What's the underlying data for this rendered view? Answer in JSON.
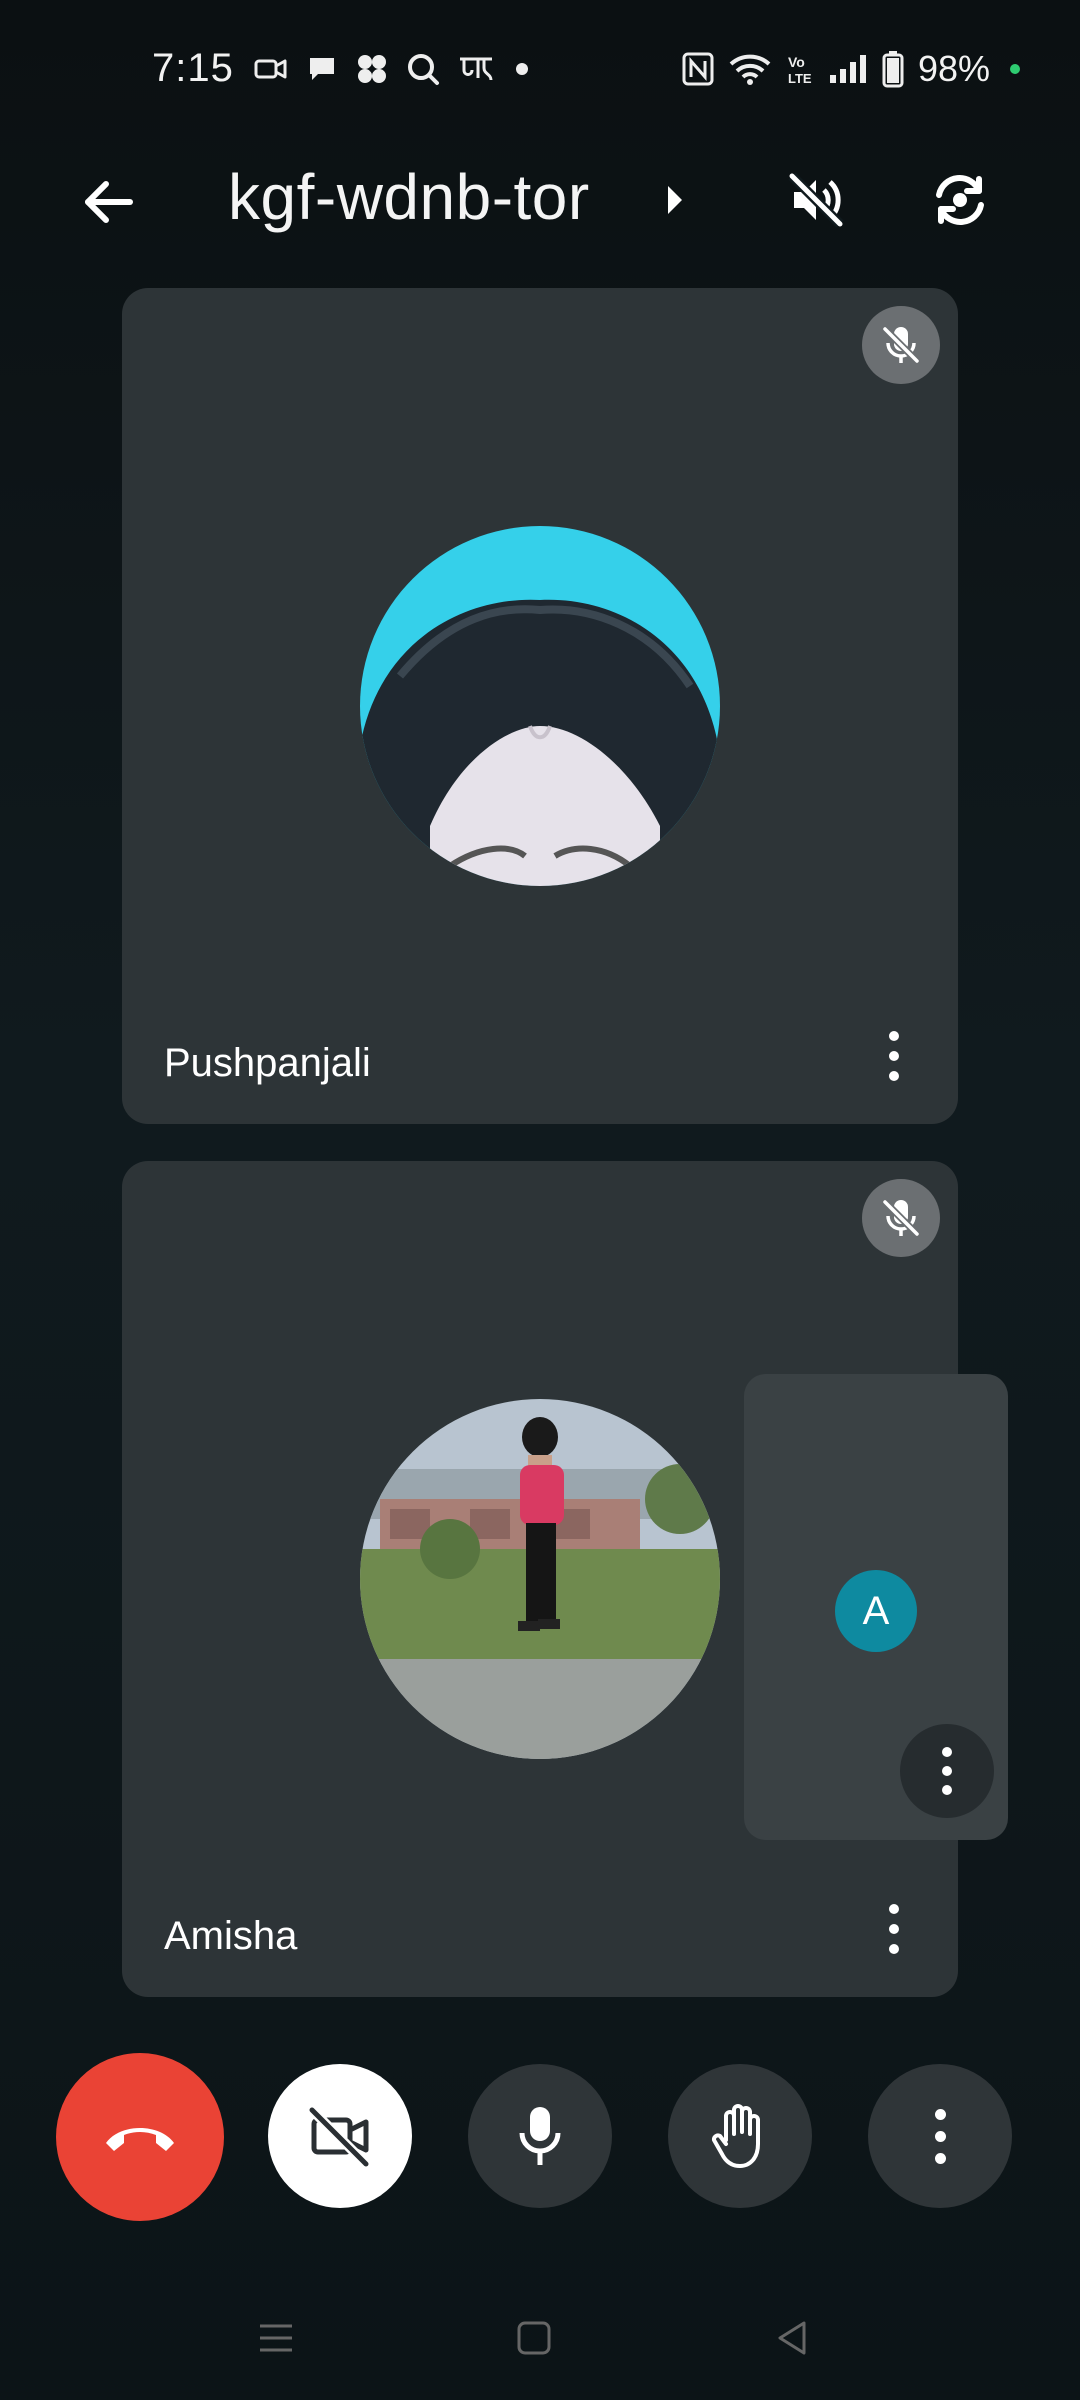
{
  "status_bar": {
    "time": "7:15",
    "battery_percent": "98%",
    "left_icons": [
      "video-call-notification-icon",
      "chat-bubble-icon",
      "pinwheel-app-icon",
      "search-app-icon",
      "hindi-news-app-icon",
      "more-notifications-dot-icon"
    ],
    "right_icons": [
      "nfc-icon",
      "wifi-icon",
      "volte-icon",
      "signal-icon",
      "battery-icon"
    ],
    "indicator_color": "#2ecc71"
  },
  "app_bar": {
    "meeting_code": "kgf-wdnb-tor",
    "icons": [
      "back-arrow-icon",
      "caret-right-icon",
      "speaker-off-icon",
      "switch-camera-icon"
    ]
  },
  "participants": [
    {
      "name": "Pushpanjali",
      "muted": true,
      "avatar": "photo"
    },
    {
      "name": "Amisha",
      "muted": true,
      "avatar": "photo"
    }
  ],
  "self_view": {
    "initial": "A",
    "avatar_color": "#0e8aa0"
  },
  "controls": {
    "end_call_color": "#ea4335",
    "camera_off": true,
    "mic_on": true,
    "icons": [
      "end-call-icon",
      "camera-off-icon",
      "mic-icon",
      "raise-hand-icon",
      "more-vert-icon"
    ]
  },
  "nav_bar": {
    "icons": [
      "recents-icon",
      "home-icon",
      "back-triangle-icon"
    ]
  }
}
